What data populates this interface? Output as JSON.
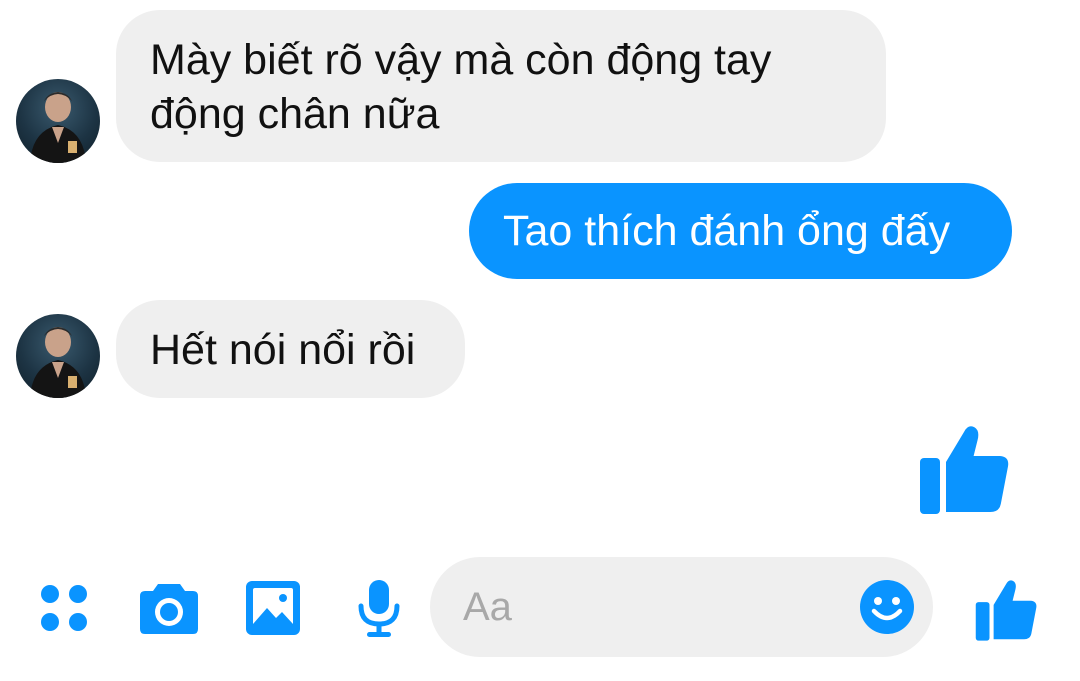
{
  "conversation": {
    "messages": [
      {
        "from": "contact",
        "text": "Mày biết rõ vậy mà còn động tay động chân nữa"
      },
      {
        "from": "me",
        "text": "Tao thích đánh ổng đấy"
      },
      {
        "from": "contact",
        "text": "Hết nói nổi rồi"
      },
      {
        "from": "me",
        "type": "like-sticker"
      }
    ]
  },
  "composer": {
    "placeholder": "Aa",
    "icons": [
      "menu-dots-icon",
      "camera-icon",
      "gallery-icon",
      "microphone-icon",
      "emoji-icon",
      "like-icon"
    ]
  },
  "colors": {
    "accent": "#0a94ff",
    "incoming_bubble": "#efefef",
    "incoming_text": "#111111",
    "outgoing_text": "#ffffff",
    "placeholder": "#a8a8a8"
  }
}
